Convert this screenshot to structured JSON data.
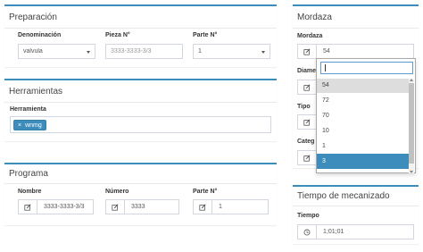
{
  "preparacion": {
    "title": "Preparación",
    "denominacion": {
      "label": "Denominación",
      "value": "valvula"
    },
    "pieza": {
      "label": "Pieza N°",
      "placeholder": "3333-3333-3/3"
    },
    "parte": {
      "label": "Parte N°",
      "value": "1"
    }
  },
  "herramientas": {
    "title": "Herramientas",
    "label": "Herramienta",
    "tags": [
      {
        "remove": "×",
        "text": "wnmg"
      }
    ]
  },
  "programa": {
    "title": "Programa",
    "nombre": {
      "label": "Nombre",
      "value": "3333-3333-3/3"
    },
    "numero": {
      "label": "Número",
      "value": "3333"
    },
    "parte": {
      "label": "Parte N°",
      "value": "1"
    }
  },
  "mordaza": {
    "title": "Mordaza",
    "mordaza": {
      "label": "Mordaza",
      "value": "54"
    },
    "diametro": {
      "label": "Diame"
    },
    "tipo": {
      "label": "Tipo"
    },
    "categoria": {
      "label": "Categ"
    },
    "dropdown": {
      "search_value": "",
      "options": [
        "54",
        "72",
        "70",
        "10",
        "1",
        "3"
      ],
      "highlighted_index": 0,
      "selected_index": 5
    }
  },
  "tiempo": {
    "title": "Tiempo de mecanizado",
    "label": "Tiempo",
    "value": "1;01;01"
  },
  "icons": {
    "edit": "pencil-square-icon",
    "clock": "clock-icon"
  },
  "colors": {
    "accent": "#3c8dbc",
    "selected_option": "#3c8dbc",
    "highlighted_option": "#dddddd"
  }
}
